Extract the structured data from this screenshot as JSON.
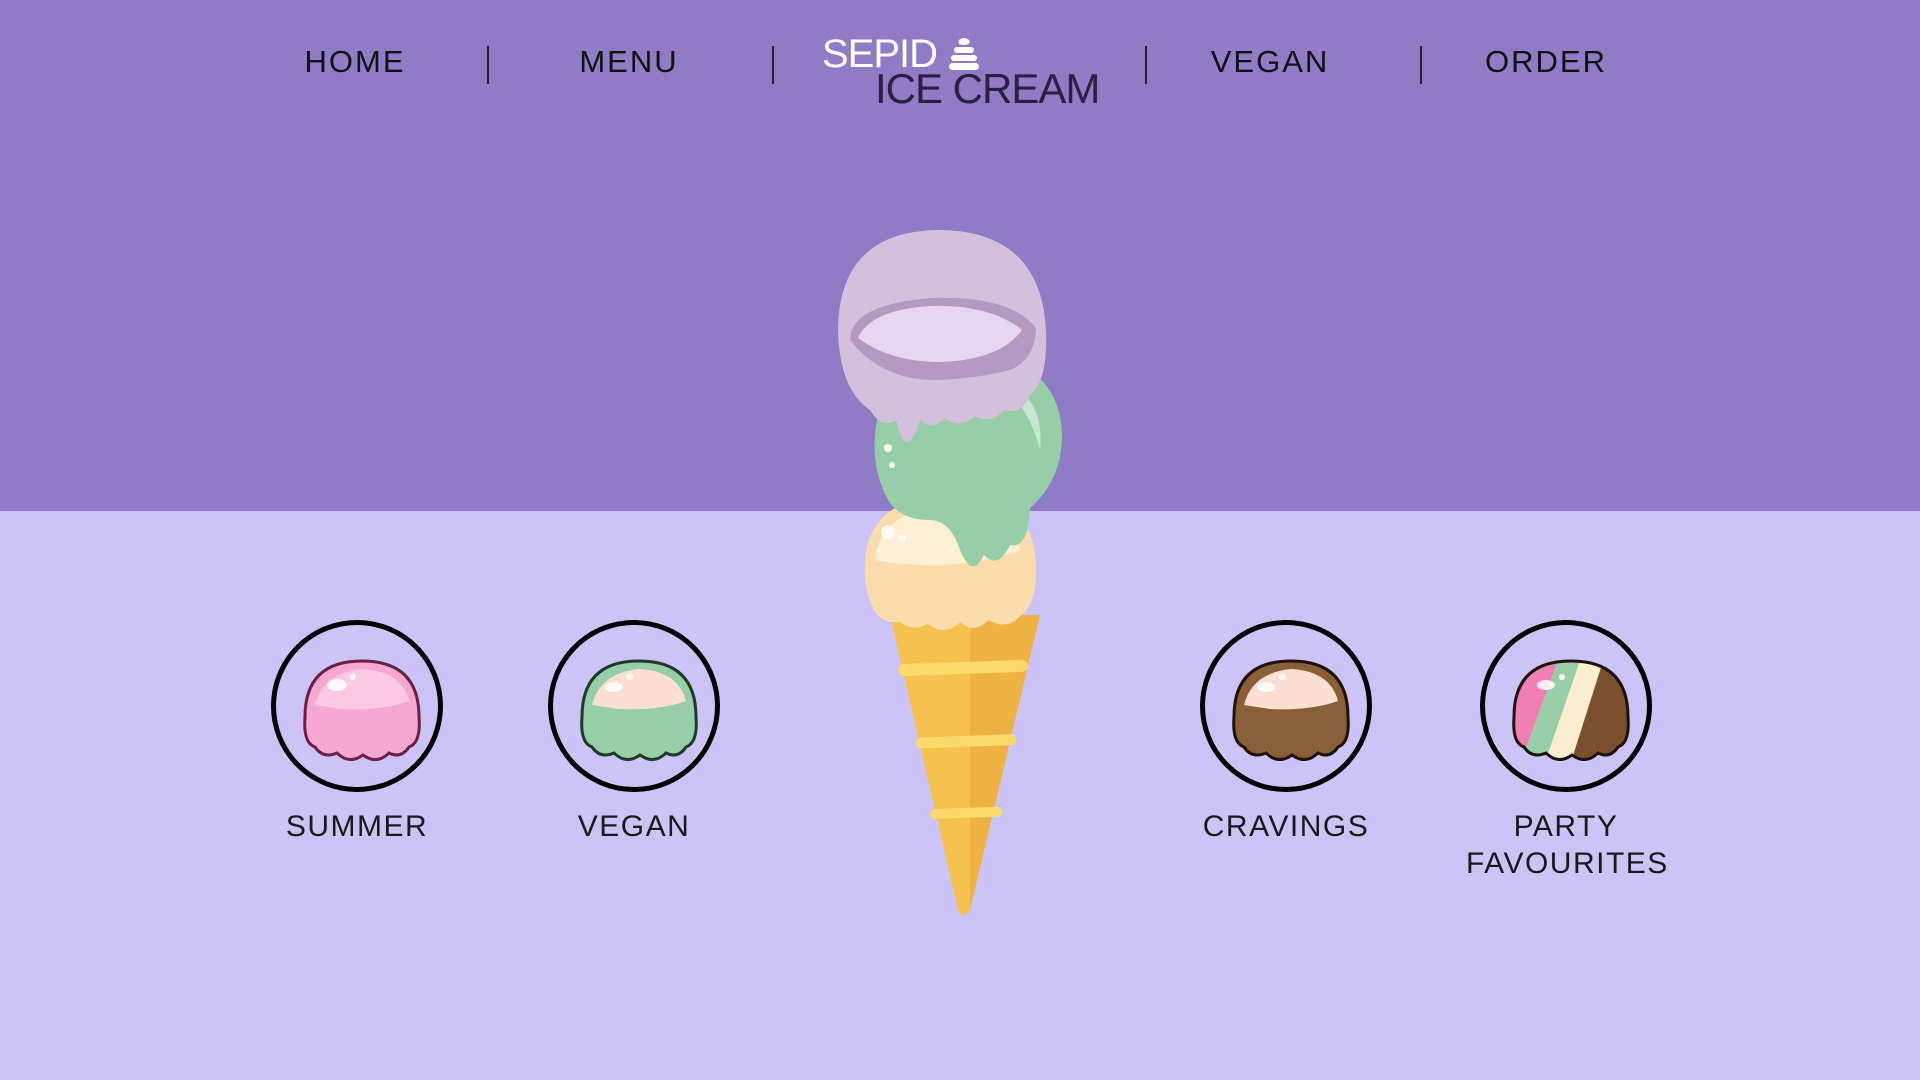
{
  "colors": {
    "top_background": "#8f7cc6",
    "bottom_background": "#ccc4f7",
    "nav_text": "#111111",
    "logo_light": "#ffffff",
    "logo_dark": "#2a2140",
    "scoop_pink": "#f6a9d0",
    "scoop_green": "#96cfa6",
    "scoop_brown": "#8a5e37",
    "scoop_cream": "#fbefd0",
    "cone": "#f6c24e"
  },
  "nav": {
    "items": [
      {
        "label": "HOME"
      },
      {
        "label": "MENU"
      },
      {
        "label": "VEGAN"
      },
      {
        "label": "ORDER"
      }
    ]
  },
  "logo": {
    "line1": "SEPID",
    "line2": "ICE CREAM",
    "icon": "soft-serve-icon"
  },
  "hero": {
    "image": "ice-cream-cone-illustration",
    "scoops": [
      "lavender",
      "mint-green",
      "vanilla"
    ]
  },
  "categories": [
    {
      "label": "SUMMER",
      "icon": "pink-scoop-icon"
    },
    {
      "label": "VEGAN",
      "icon": "green-scoop-icon"
    },
    {
      "label": "CRAVINGS",
      "icon": "chocolate-scoop-icon"
    },
    {
      "label": "PARTY\nFAVOURITES",
      "icon": "multi-flavor-scoop-icon"
    }
  ]
}
